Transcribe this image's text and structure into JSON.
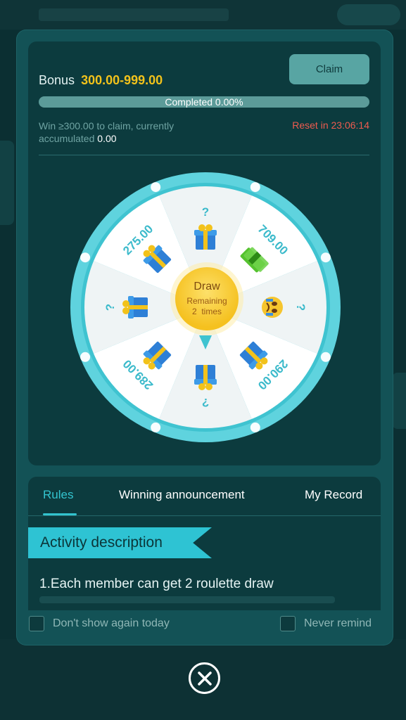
{
  "bonus": {
    "label": "Bonus",
    "range": "300.00-999.00"
  },
  "claim_label": "Claim",
  "progress": {
    "text": "Completed 0.00%",
    "percent": 0
  },
  "win_info": {
    "text": "Win ≥300.00 to claim, currently accumulated",
    "accumulated": "0.00"
  },
  "reset": {
    "text": "Reset in 23:06:14"
  },
  "wheel": {
    "segments": [
      {
        "label": "?",
        "icon": "gift-box-icon"
      },
      {
        "label": "709.00",
        "icon": "cash-stack-icon"
      },
      {
        "label": "?",
        "icon": "crying-emoji-icon"
      },
      {
        "label": "290.00",
        "icon": "gift-box-icon"
      },
      {
        "label": "?",
        "icon": "gift-box-icon"
      },
      {
        "label": "289.00",
        "icon": "gift-box-icon"
      },
      {
        "label": "?",
        "icon": "gift-box-icon"
      },
      {
        "label": "275.00",
        "icon": "gift-box-icon"
      }
    ],
    "center": {
      "label": "Draw",
      "remaining_prefix": "Remaining",
      "remaining_count": "2",
      "remaining_suffix": "times"
    }
  },
  "tabs": [
    {
      "label": "Rules",
      "active": true
    },
    {
      "label": "Winning announcement",
      "active": false
    },
    {
      "label": "My Record",
      "active": false
    }
  ],
  "activity": {
    "title": "Activity description",
    "rule_1": "1.Each member can get 2 roulette draw"
  },
  "footer": {
    "dont_show": "Don't show again today",
    "never_remind": "Never remind"
  },
  "colors": {
    "accent": "#33c4cf",
    "bonus_gold": "#f2c21b",
    "reset_red": "#ef5b4f",
    "panel": "#0c3b3e",
    "modal": "#135256"
  }
}
